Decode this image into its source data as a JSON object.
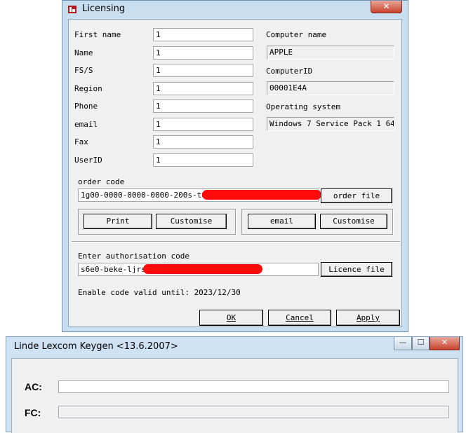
{
  "licensing": {
    "title": "Licensing",
    "close_label": "✕",
    "labels": {
      "first_name": "First name",
      "name": "Name",
      "fs": "FS/S",
      "region": "Region",
      "phone": "Phone",
      "email": "email",
      "fax": "Fax",
      "userid": "UserID",
      "computer_name": "Computer name",
      "computer_id": "ComputerID",
      "os": "Operating system",
      "order_code": "order code",
      "auth_code": "Enter authorisation code",
      "valid_until": "Enable code valid until: 2023/12/30"
    },
    "values": {
      "first_name": "1",
      "name": "1",
      "fs": "1",
      "region": "1",
      "phone": "1",
      "email": "1",
      "fax": "1",
      "userid": "1",
      "computer_name": "APPLE",
      "computer_id": "00001E4A",
      "os": "Windows 7 Service Pack 1 64",
      "order_code": "1g00-0000-0000-0000-200s-t60g",
      "auth_code": "s6e0-beke-ljrs-"
    },
    "buttons": {
      "order_file": "order file",
      "print": "Print",
      "customise_left": "Customise",
      "email": "email",
      "customise_right": "Customise",
      "licence_file": "Licence file",
      "ok": "OK",
      "cancel": "Cancel",
      "apply": "Apply"
    }
  },
  "keygen": {
    "title": "Linde Lexcom Keygen <13.6.2007>",
    "labels": {
      "ac": "AC:",
      "fc": "FC:"
    },
    "values": {
      "ac": "",
      "fc": ""
    },
    "controls": {
      "minimize": "—",
      "maximize": "☐",
      "close": "✕"
    }
  },
  "colors": {
    "redaction": "#ff0b0b",
    "frame": "#c9dff0",
    "close": "#c7432c"
  }
}
